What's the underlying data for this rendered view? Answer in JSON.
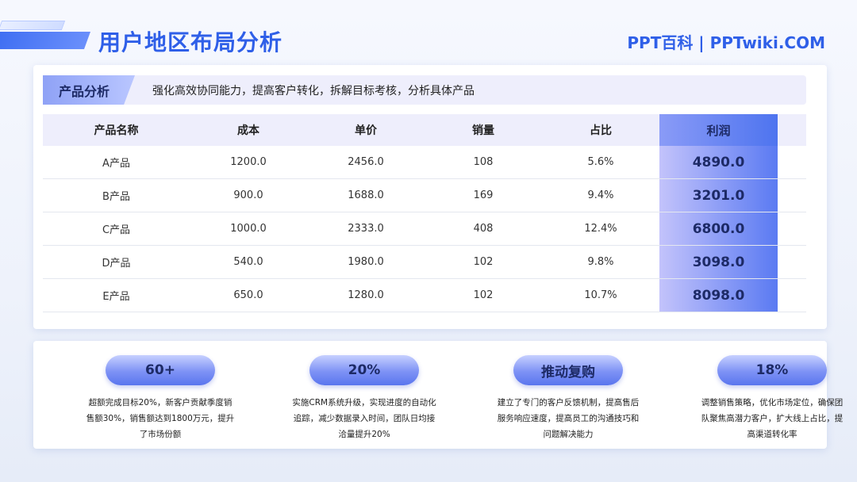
{
  "header": {
    "title": "用户地区布局分析",
    "brand": "PPT百科 | PPTwiki.COM"
  },
  "banner": {
    "tag": "产品分析",
    "text": "强化高效协同能力，提高客户转化，拆解目标考核，分析具体产品"
  },
  "table": {
    "columns": [
      "产品名称",
      "成本",
      "单价",
      "销量",
      "占比",
      "利润"
    ],
    "rows": [
      [
        "A产品",
        "1200.0",
        "2456.0",
        "108",
        "5.6%",
        "4890.0"
      ],
      [
        "B产品",
        "900.0",
        "1688.0",
        "169",
        "9.4%",
        "3201.0"
      ],
      [
        "C产品",
        "1000.0",
        "2333.0",
        "408",
        "12.4%",
        "6800.0"
      ],
      [
        "D产品",
        "540.0",
        "1980.0",
        "102",
        "9.8%",
        "3098.0"
      ],
      [
        "E产品",
        "650.0",
        "1280.0",
        "102",
        "10.7%",
        "8098.0"
      ]
    ]
  },
  "stats": [
    {
      "value": "60+",
      "desc": "超额完成目标20%，新客户贡献季度销售额30%，销售额达到1800万元，提升了市场份额"
    },
    {
      "value": "20%",
      "desc": "实施CRM系统升级，实现进度的自动化追踪，减少数据录入时间，团队日均接洽量提升20%"
    },
    {
      "value": "推动复购",
      "desc": "建立了专门的客户反馈机制，提高售后服务响应速度，提高员工的沟通技巧和问题解决能力"
    },
    {
      "value": "18%",
      "desc": "调整销售策略，优化市场定位，确保团队聚焦高潜力客户，扩大线上占比，提高渠道转化率"
    }
  ],
  "colors": {
    "accent": "#2f5fe8",
    "banner_bg": "#eeeefc"
  }
}
